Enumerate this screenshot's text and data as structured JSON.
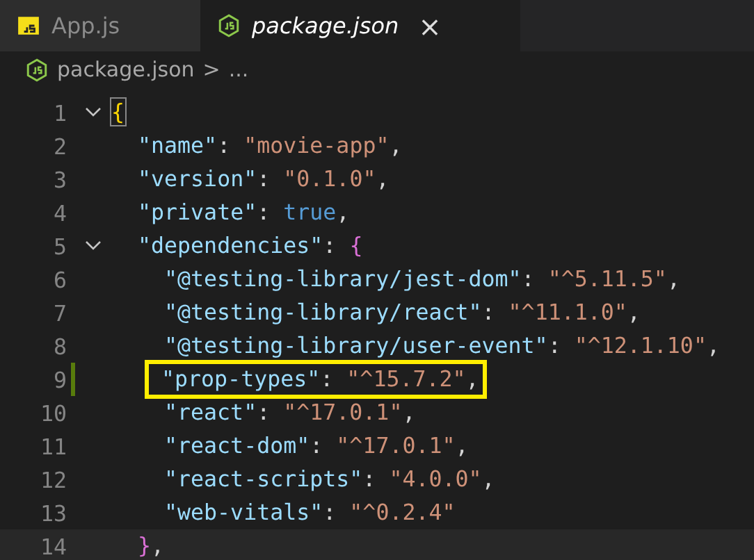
{
  "tabs": [
    {
      "label": "App.js",
      "selected": false
    },
    {
      "label": "package.json",
      "selected": true,
      "close": "×"
    }
  ],
  "breadcrumb": {
    "file": "package.json",
    "separator": ">",
    "more": "..."
  },
  "lines": [
    {
      "number": "1",
      "kind": "root",
      "fold": true,
      "tokens": [
        {
          "kind": "brace1",
          "text": "{"
        }
      ]
    },
    {
      "number": "2",
      "kind": "field",
      "tokens": [
        {
          "kind": "key",
          "text": "\"name\""
        },
        {
          "kind": "punct",
          "text": ": "
        },
        {
          "kind": "string",
          "text": "\"movie-app\""
        },
        {
          "kind": "punct",
          "text": ","
        }
      ]
    },
    {
      "number": "3",
      "kind": "field",
      "tokens": [
        {
          "kind": "key",
          "text": "\"version\""
        },
        {
          "kind": "punct",
          "text": ": "
        },
        {
          "kind": "string",
          "text": "\"0.1.0\""
        },
        {
          "kind": "punct",
          "text": ","
        }
      ]
    },
    {
      "number": "4",
      "kind": "field",
      "tokens": [
        {
          "kind": "key",
          "text": "\"private\""
        },
        {
          "kind": "punct",
          "text": ": "
        },
        {
          "kind": "bool",
          "text": "true"
        },
        {
          "kind": "punct",
          "text": ","
        }
      ]
    },
    {
      "number": "5",
      "kind": "field",
      "fold": true,
      "tokens": [
        {
          "kind": "key",
          "text": "\"dependencies\""
        },
        {
          "kind": "punct",
          "text": ": "
        },
        {
          "kind": "brace2",
          "text": "{"
        }
      ]
    },
    {
      "number": "6",
      "kind": "entry",
      "tokens": [
        {
          "kind": "key",
          "text": "\"@testing-library/jest-dom\""
        },
        {
          "kind": "punct",
          "text": ": "
        },
        {
          "kind": "string",
          "text": "\"^5.11.5\""
        },
        {
          "kind": "punct",
          "text": ","
        }
      ]
    },
    {
      "number": "7",
      "kind": "entry",
      "tokens": [
        {
          "kind": "key",
          "text": "\"@testing-library/react\""
        },
        {
          "kind": "punct",
          "text": ": "
        },
        {
          "kind": "string",
          "text": "\"^11.1.0\""
        },
        {
          "kind": "punct",
          "text": ","
        }
      ]
    },
    {
      "number": "8",
      "kind": "entry",
      "tokens": [
        {
          "kind": "key",
          "text": "\"@testing-library/user-event\""
        },
        {
          "kind": "punct",
          "text": ": "
        },
        {
          "kind": "string",
          "text": "\"^12.1.10\""
        },
        {
          "kind": "punct",
          "text": ","
        }
      ]
    },
    {
      "number": "9",
      "kind": "entry",
      "modified": true,
      "highlighted": true,
      "tokens": [
        {
          "kind": "key",
          "text": "\"prop-types\""
        },
        {
          "kind": "punct",
          "text": ": "
        },
        {
          "kind": "string",
          "text": "\"^15.7.2\""
        },
        {
          "kind": "punct",
          "text": ","
        }
      ]
    },
    {
      "number": "10",
      "kind": "entry",
      "tokens": [
        {
          "kind": "key",
          "text": "\"react\""
        },
        {
          "kind": "punct",
          "text": ": "
        },
        {
          "kind": "string",
          "text": "\"^17.0.1\""
        },
        {
          "kind": "punct",
          "text": ","
        }
      ]
    },
    {
      "number": "11",
      "kind": "entry",
      "tokens": [
        {
          "kind": "key",
          "text": "\"react-dom\""
        },
        {
          "kind": "punct",
          "text": ": "
        },
        {
          "kind": "string",
          "text": "\"^17.0.1\""
        },
        {
          "kind": "punct",
          "text": ","
        }
      ]
    },
    {
      "number": "12",
      "kind": "entry",
      "tokens": [
        {
          "kind": "key",
          "text": "\"react-scripts\""
        },
        {
          "kind": "punct",
          "text": ": "
        },
        {
          "kind": "string",
          "text": "\"4.0.0\""
        },
        {
          "kind": "punct",
          "text": ","
        }
      ]
    },
    {
      "number": "13",
      "kind": "entry",
      "tokens": [
        {
          "kind": "key",
          "text": "\"web-vitals\""
        },
        {
          "kind": "punct",
          "text": ": "
        },
        {
          "kind": "string",
          "text": "\"^0.2.4\""
        }
      ]
    },
    {
      "number": "14",
      "kind": "field",
      "current": true,
      "tokens": [
        {
          "kind": "brace2",
          "text": "}"
        },
        {
          "kind": "punct",
          "text": ","
        }
      ]
    }
  ]
}
